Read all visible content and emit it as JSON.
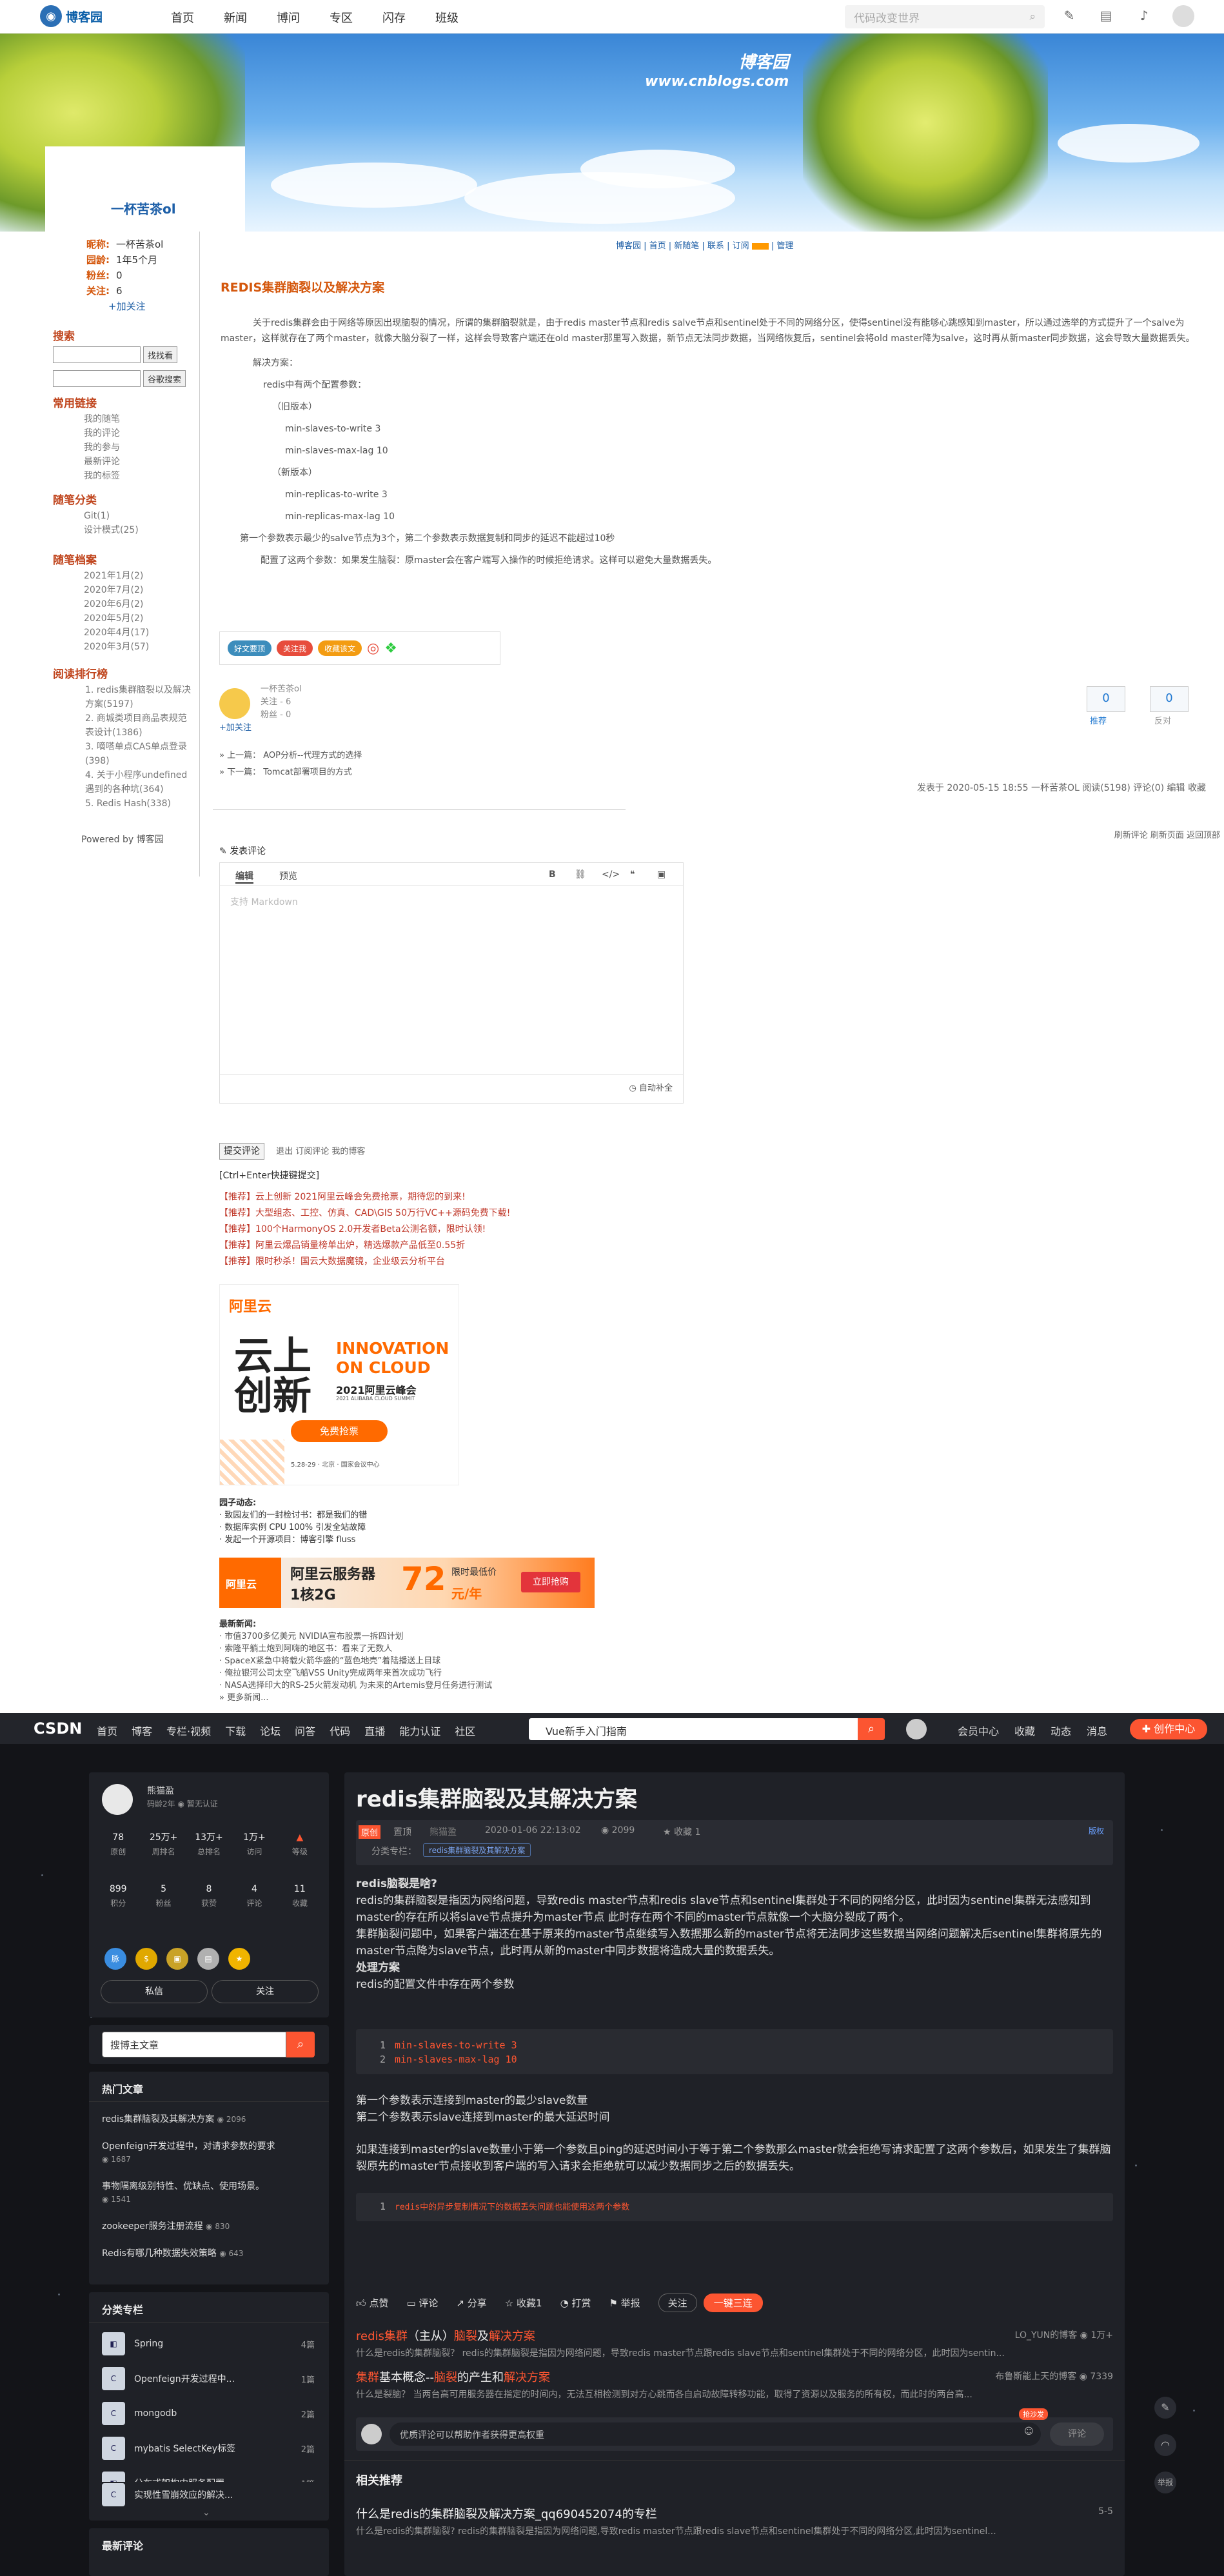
{
  "cnblogs": {
    "logo": "博客园",
    "nav": [
      "首页",
      "新闻",
      "博问",
      "专区",
      "闪存",
      "班级"
    ],
    "search_placeholder": "代码改变世界",
    "banner_text_1": "博客园",
    "banner_text_2": "www.cnblogs.com",
    "blog_title": "一杯苦茶ol",
    "profile": [
      {
        "k": "昵称:",
        "v": "一杯苦茶ol"
      },
      {
        "k": "园龄:",
        "v": "1年5个月"
      },
      {
        "k": "粉丝:",
        "v": "0"
      },
      {
        "k": "关注:",
        "v": "6"
      }
    ],
    "follow": "+加关注",
    "sidebar": {
      "search_title": "搜索",
      "find_btn": "找找看",
      "google_btn": "谷歌搜索",
      "links_title": "常用链接",
      "links": [
        "我的随笔",
        "我的评论",
        "我的参与",
        "最新评论",
        "我的标签"
      ],
      "cat_title": "随笔分类",
      "cats": [
        "Git(1)",
        "设计模式(25)"
      ],
      "archive_title": "随笔档案",
      "archives": [
        "2021年1月(2)",
        "2020年7月(2)",
        "2020年6月(2)",
        "2020年5月(2)",
        "2020年4月(17)",
        "2020年3月(57)"
      ],
      "rank_title": "阅读排行榜",
      "rank": [
        "1. redis集群脑裂以及解决",
        "方案(5197)",
        "2. 商城类项目商品表规范",
        "表设计(1386)",
        "3. 嘀嗒单点CAS单点登录",
        "(398)",
        "4. 关于小程序undefined",
        "遇到的各种坑(364)",
        "5. Redis Hash(338)"
      ],
      "powered": "Powered by 博客园"
    },
    "top_links": "博客园 | 首页 | 新随笔 | 联系 | 订阅",
    "top_links_end": "| 管理",
    "post_title": "REDIS集群脑裂以及解决方案",
    "post_p1": "关于redis集群会由于网络等原因出现脑裂的情况，所谓的集群脑裂就是，由于redis master节点和redis salve节点和sentinel处于不同的网络分区，使得sentinel没有能够心跳感知到master，所以通过选举的方式提升了一个salve为master，这样就存在了两个master，就像大脑分裂了一样，这样会导致客户端还在old master那里写入数据，新节点无法同步数据，当网络恢复后，sentinel会将old master降为salve，这时再从新master同步数据，这会导致大量数据丢失。",
    "post_p2": "解决方案：",
    "post_p3": "redis中有两个配置参数：",
    "post_p4": "（旧版本）",
    "post_p5": "min-slaves-to-write 3",
    "post_p6": "min-slaves-max-lag 10",
    "post_p7": "（新版本）",
    "post_p8": "min-replicas-to-write 3",
    "post_p9": "min-replicas-max-lag 10",
    "post_p10": "第一个参数表示最少的salve节点为3个，第二个参数表示数据复制和同步的延迟不能超过10秒",
    "post_p11": "配置了这两个参数：如果发生脑裂：原master会在客户端写入操作的时候拒绝请求。这样可以避免大量数据丢失。",
    "share": [
      "好文要顶",
      "关注我",
      "收藏该文"
    ],
    "author_name": "一杯苦茶ol",
    "author_follow": "关注 - 6",
    "author_fans": "粉丝 - 0",
    "author_add": "+加关注",
    "vote_up": "0",
    "vote_down": "0",
    "vote_up_label": "推荐",
    "vote_down_label": "反对",
    "prev": "» 上一篇：  AOP分析--代理方式的选择",
    "next": "» 下一篇：  Tomcat部署项目的方式",
    "post_meta": "发表于 2020-05-15 18:55  一杯苦茶OL  阅读(5198)  评论(0)  编辑  收藏",
    "cmt_tools": "刷新评论    刷新页面    返回顶部",
    "cmt_title": "发表评论",
    "tab_edit": "编辑",
    "tab_preview": "预览",
    "editor_ph": "支持 Markdown",
    "autosave": "自动补全",
    "submit": "提交评论",
    "submit_links": "退出    订阅评论    我的博客",
    "ctrl_tip": "[Ctrl+Enter快捷键提交]",
    "ads": [
      "【推荐】云上创新 2021阿里云峰会免费抢票，期待您的到来!",
      "【推荐】大型组态、工控、仿真、CAD\\GIS 50万行VC++源码免费下载!",
      "【推荐】100个HarmonyOS 2.0开发者Beta公测名额，限时认领!",
      "【推荐】阿里云爆品销量榜单出炉，精选爆款产品低至0.55折",
      "【推荐】限时秒杀！国云大数据魔镜，企业级云分析平台"
    ],
    "aliyun1": {
      "brand": "阿里云",
      "big": "云上创新",
      "en1": "INNOVATION",
      "en2": "ON CLOUD",
      "sub": "2021阿里云峰会",
      "sub2": "2021 ALIBABA CLOUD SUMMIT",
      "btn": "免费抢票",
      "date": "5.28-29 · 北京 · 国家会议中心"
    },
    "gz_title": "园子动态:",
    "gz": [
      "· 致园友们的一封检讨书：都是我们的错",
      "· 数据库实例 CPU 100% 引发全站故障",
      "· 发起一个开源项目：博客引擎 fluss"
    ],
    "aliyun2": {
      "brand": "阿里云",
      "t1": "阿里云服务器",
      "t2": "1核2G",
      "price": "72",
      "unit": "元/年",
      "note": "限时最低价",
      "btn": "立即抢购"
    },
    "news_title": "最新新闻:",
    "news": [
      "· 市值3700多亿美元 NVIDIA宣布股票一拆四计划",
      "· 索隆平躺土炮到阿嗨的地区书：看来了无数人",
      "· SpaceX紧急中将载火箭华盛的“蓝色地壳”着陆播送上目球",
      "· 俺拉银河公司太空飞船VSS Unity完成两年来首次成功飞行",
      "· NASA选择印大的RS-25火箭发动机 为未来的Artemis登月任务进行测试",
      "» 更多新闻..."
    ]
  },
  "csdn": {
    "logo": "CSDN",
    "nav": [
      "首页",
      "博客",
      "专栏·视频",
      "下载",
      "论坛",
      "问答",
      "代码",
      "直播",
      "能力认证",
      "社区"
    ],
    "search_text": "Vue新手入门指南",
    "right": [
      "会员中心",
      "收藏",
      "动态",
      "消息"
    ],
    "create": "创作中心",
    "user_name": "熊猫盈",
    "user_years": "码龄2年",
    "user_auth": "暂无认证",
    "stats1": [
      {
        "v": "78",
        "k": "原创"
      },
      {
        "v": "25万+",
        "k": "周排名"
      },
      {
        "v": "13万+",
        "k": "总排名"
      },
      {
        "v": "1万+",
        "k": "访问"
      },
      {
        "v": "",
        "k": "等级"
      }
    ],
    "stats2": [
      {
        "v": "899",
        "k": "积分"
      },
      {
        "v": "5",
        "k": "粉丝"
      },
      {
        "v": "8",
        "k": "获赞"
      },
      {
        "v": "4",
        "k": "评论"
      },
      {
        "v": "11",
        "k": "收藏"
      }
    ],
    "btn_msg": "私信",
    "btn_follow": "关注",
    "search_ph": "搜博主文章",
    "hot_title": "热门文章",
    "hot": [
      {
        "t": "redis集群脑裂及其解决方案",
        "v": "2096"
      },
      {
        "t": "Openfeign开发过程中，对请求参数的要求",
        "v": "1687"
      },
      {
        "t": "事物隔离级别特性、优缺点、使用场景。",
        "v": "1541"
      },
      {
        "t": "zookeeper服务注册流程",
        "v": "830"
      },
      {
        "t": "Redis有哪几种数据失效策略",
        "v": "643"
      }
    ],
    "col_title": "分类专栏",
    "cols": [
      {
        "n": "Spring",
        "c": "4篇"
      },
      {
        "n": "Openfeign开发过程中...",
        "c": "1篇"
      },
      {
        "n": "mongodb",
        "c": "2篇"
      },
      {
        "n": "mybatis SelectKey标签",
        "c": "2篇"
      },
      {
        "n": "分布式架构中服务配置...",
        "c": "1篇"
      },
      {
        "n": "实现性雪崩效应的解决...",
        "c": ""
      }
    ],
    "latest_title": "最新评论",
    "title": "redis集群脑裂及其解决方案",
    "tag_orig": "原创",
    "meta_ding": "置顶",
    "meta_author": "熊猫盈",
    "meta_date": "2020-01-06 22:13:02",
    "meta_views": "2099",
    "meta_fav": "收藏 1",
    "meta_copy": "版权",
    "meta_col_label": "分类专栏：",
    "meta_col_tag": "redis集群脑裂及其解决方案",
    "body": [
      {
        "b": true,
        "t": "redis脑裂是啥?"
      },
      {
        "b": false,
        "t": "redis的集群脑裂是指因为网络问题，导致redis master节点和redis slave节点和sentinel集群处于不同的网络分区，此时因为sentinel集群无法感知到master的存在所以将slave节点提升为master节点 此时存在两个不同的master节点就像一个大脑分裂成了两个。"
      },
      {
        "b": false,
        "t": "集群脑裂问题中，如果客户端还在基于原来的master节点继续写入数据那么新的master节点将无法同步这些数据当网络问题解决后sentinel集群将原先的master节点降为slave节点，此时再从新的master中同步数据将造成大量的数据丢失。"
      },
      {
        "b": true,
        "t": "处理方案"
      },
      {
        "b": false,
        "t": "redis的配置文件中存在两个参数"
      }
    ],
    "code1": [
      "min-slaves-to-write 3",
      "min-slaves-max-lag 10"
    ],
    "body2": [
      "第一个参数表示连接到master的最少slave数量",
      "第二个参数表示slave连接到master的最大延迟时间"
    ],
    "body3": "如果连接到master的slave数量小于第一个参数且ping的延迟时间小于等于第二个参数那么master就会拒绝写请求配置了这两个参数后，如果发生了集群脑裂原先的master节点接收到客户端的写入请求会拒绝就可以减少数据同步之后的数据丢失。",
    "code2": "redis中的异步复制情况下的数据丢失问题也能使用这两个参数",
    "tools": [
      "点赞",
      "评论",
      "分享",
      "收藏1",
      "打赏",
      "举报"
    ],
    "tool_follow": "关注",
    "tool_triple": "一键三连",
    "rel1_title_a": "redis集群",
    "rel1_title_b": "（主从）",
    "rel1_title_c": "脑裂",
    "rel1_title_d": "及",
    "rel1_title_e": "解决方案",
    "rel1_author": "LO_YUN的博客",
    "rel1_views": "1万+",
    "rel1_desc": "什么是redis的集群脑裂？ redis的集群脑裂是指因为网络问题，导致redis master节点跟redis slave节点和sentinel集群处于不同的网络分区，此时因为sentin...",
    "rel2_title_a": "集群",
    "rel2_title_b": "基本概念--",
    "rel2_title_c": "脑裂",
    "rel2_title_d": "的产生和",
    "rel2_title_e": "解决方案",
    "rel2_author": "布鲁斯能上天的博客",
    "rel2_views": "7339",
    "rel2_desc": "什么是裂脑？ 当两台高可用服务器在指定的时间内，无法互相检测到对方心跳而各自启动故障转移功能，取得了资源以及服务的所有权，而此时的两台高...",
    "comment_ph": "优质评论可以帮助作者获得更高权重",
    "comment_btn": "评论",
    "comment_badge": "抢沙发",
    "rec_title": "相关推荐",
    "rec1_title": "什么是redis的集群脑裂及解决方案_qq690452074的专栏",
    "rec1_date": "5-5",
    "rec1_desc": "什么是redis的集群脑裂? redis的集群脑裂是指因为网络问题,导致redis master节点跟redis slave节点和sentinel集群处于不同的网络分区,此时因为sentinel...",
    "fab_report": "举报"
  }
}
